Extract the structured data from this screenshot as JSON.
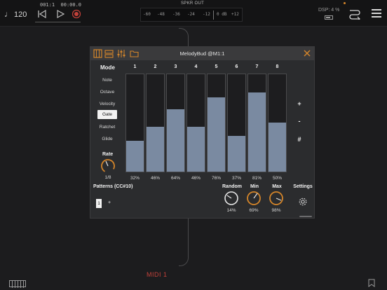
{
  "topbar": {
    "tempo": "120",
    "position_bars": "001:1",
    "position_time": "00:00.0",
    "meter_title": "SPKR OUT",
    "meter_labels": [
      "-60",
      "-48",
      "-36",
      "-24",
      "-12",
      "0 dB",
      "+12"
    ],
    "dsp": "DSP: 4 %"
  },
  "plugin": {
    "title": "MelodyBud @M1:1",
    "mode_title": "Mode",
    "modes": [
      "Note",
      "Octave",
      "Velocity",
      "Gate",
      "Ratchet",
      "Glide"
    ],
    "active_mode": "Gate",
    "rate_label": "Rate",
    "rate_value": "1/8",
    "steps": [
      {
        "num": "1",
        "value": 0.32,
        "label": "32%"
      },
      {
        "num": "2",
        "value": 0.46,
        "label": "46%"
      },
      {
        "num": "3",
        "value": 0.64,
        "label": "64%"
      },
      {
        "num": "4",
        "value": 0.46,
        "label": "46%"
      },
      {
        "num": "5",
        "value": 0.76,
        "label": "76%"
      },
      {
        "num": "6",
        "value": 0.37,
        "label": "37%"
      },
      {
        "num": "7",
        "value": 0.81,
        "label": "81%"
      },
      {
        "num": "8",
        "value": 0.5,
        "label": "50%"
      }
    ],
    "side_buttons": [
      "+",
      "-",
      "#"
    ],
    "patterns_title": "Patterns (CC#10)",
    "pattern_current": "1",
    "pattern_add": "+",
    "random_label": "Random",
    "random_value": "14%",
    "min_label": "Min",
    "min_value": "69%",
    "max_label": "Max",
    "max_value": "98%",
    "settings_label": "Settings"
  },
  "midi_label": "MIDI 1",
  "colors": {
    "accent": "#d4852a",
    "bar_fill": "#7a8aa1",
    "record": "#c4413a"
  }
}
